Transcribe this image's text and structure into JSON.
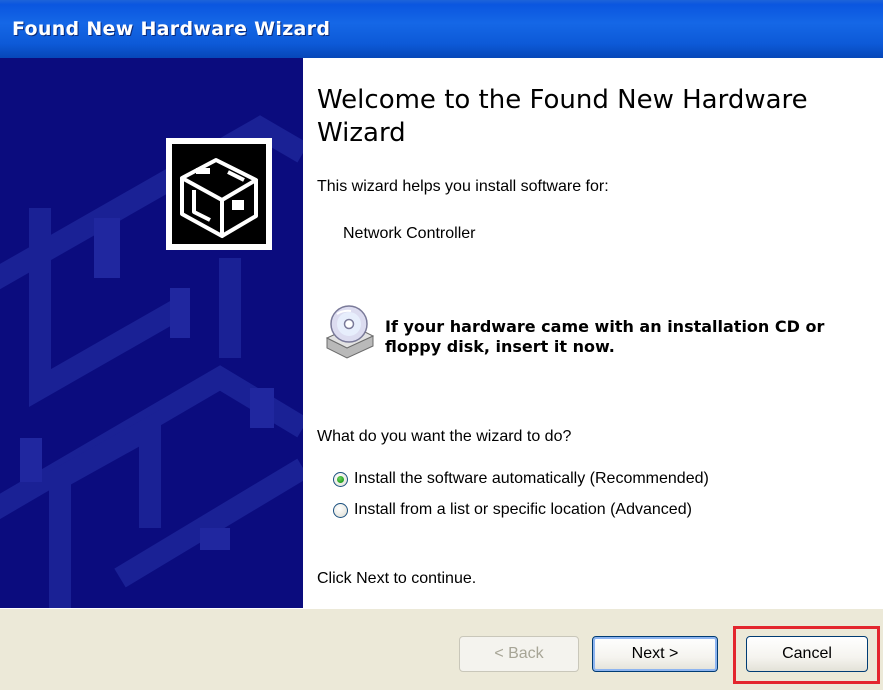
{
  "window": {
    "title": "Found New Hardware Wizard"
  },
  "content": {
    "heading": "Welcome to the Found New Hardware Wizard",
    "intro": "This wizard helps you install software for:",
    "device_name": "Network Controller",
    "cd_prompt": "If your hardware came with an installation CD or floppy disk, insert it now.",
    "question": "What do you want the wizard to do?",
    "options": [
      {
        "label": "Install the software automatically (Recommended)",
        "selected": true
      },
      {
        "label": "Install from a list or specific location (Advanced)",
        "selected": false
      }
    ],
    "continue_hint": "Click Next to continue."
  },
  "buttons": {
    "back": "< Back",
    "next": "Next >",
    "cancel": "Cancel"
  },
  "colors": {
    "titlebar": "#0a56e0",
    "sidebar": "#0b0c7e",
    "footer": "#ece9d8",
    "highlight": "#e3262e"
  },
  "icons": [
    "hardware-wizard-icon",
    "cd-drive-icon"
  ]
}
